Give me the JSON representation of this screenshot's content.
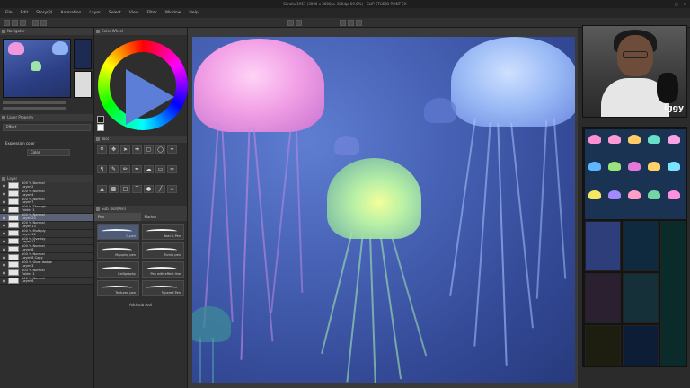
{
  "window": {
    "title": "Skrolla 1957 (3000 x 3000px 300dpi 69.8%) - CLIP STUDIO PAINT EX"
  },
  "menu": [
    "File",
    "Edit",
    "Story(P)",
    "Animation",
    "Layer",
    "Select",
    "View",
    "Filter",
    "Window",
    "Help"
  ],
  "panels": {
    "navigator": "Navigator",
    "color_wheel": "Color Wheel",
    "layer_property": "Layer Property",
    "effect_label": "Effect",
    "expression_color_label": "Expression color",
    "expression_color_value": "Color",
    "layer": "Layer",
    "tool": "Tool",
    "sub_tool": "Sub Tool(Pen)",
    "brush_tab_pen": "Pen",
    "brush_tab_marker": "Marker"
  },
  "layers": [
    {
      "line1": "100 % Normal",
      "line2": "Layer 2",
      "selected": false
    },
    {
      "line1": "100 % Normal",
      "line2": "Layer 4",
      "selected": false
    },
    {
      "line1": "100 % Normal",
      "line2": "Layer 7",
      "selected": false
    },
    {
      "line1": "100 % Through",
      "line2": "Folder 1",
      "selected": false
    },
    {
      "line1": "100 % Normal",
      "line2": "Layer 20",
      "selected": true
    },
    {
      "line1": "100 % Normal",
      "line2": "Layer 13",
      "selected": false
    },
    {
      "line1": "100 % Multiply",
      "line2": "Layer 12",
      "selected": false
    },
    {
      "line1": "100 % Overlay",
      "line2": "Layer 11",
      "selected": false
    },
    {
      "line1": "100 % Normal",
      "line2": "Layer 8",
      "selected": false
    },
    {
      "line1": "100 % Normal",
      "line2": "Layer 8 Copy",
      "selected": false
    },
    {
      "line1": "100 % Glow dodge",
      "line2": "Layer 3",
      "selected": false
    },
    {
      "line1": "100 % Normal",
      "line2": "Folder 1",
      "selected": false
    },
    {
      "line1": "100 % Normal",
      "line2": "Layer 6",
      "selected": false
    }
  ],
  "brushes": [
    {
      "label": "G-pen",
      "selected": true
    },
    {
      "label": "Real G-Pen",
      "selected": false
    },
    {
      "label": "Mapping pen",
      "selected": false
    },
    {
      "label": "Turnip pen",
      "selected": false
    },
    {
      "label": "Calligraphy",
      "selected": false
    },
    {
      "label": "Pen with effect line",
      "selected": false
    },
    {
      "label": "Textured pen",
      "selected": false
    },
    {
      "label": "Tapered Pen",
      "selected": false
    }
  ],
  "add_brush_label": "Add sub tool",
  "stream": {
    "name": "iggy"
  },
  "colors": {
    "canvas_bg": "#4863b6",
    "accent_pink": "#f3a2e7",
    "accent_green": "#b8f0a6",
    "accent_blue": "#9bbcf6"
  }
}
